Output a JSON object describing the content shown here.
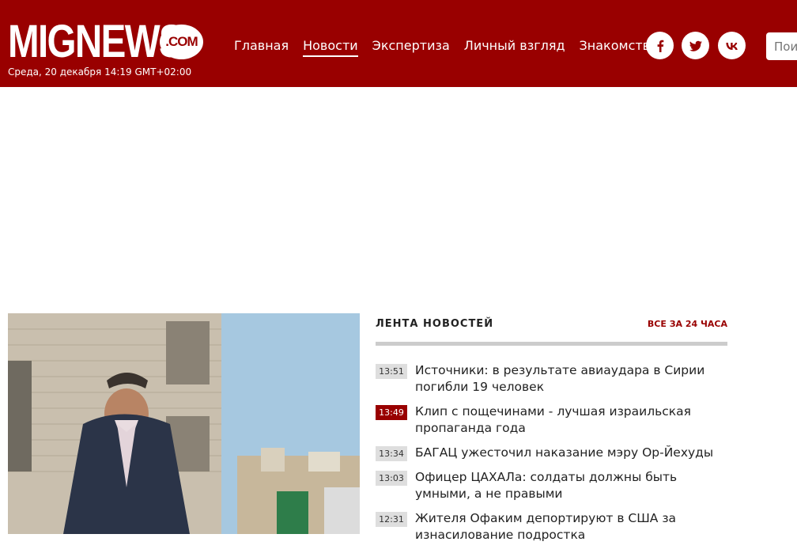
{
  "header": {
    "logo_main": "MIGNEWS",
    "logo_com": ".COM",
    "date": "Среда, 20 декабря 14:19 GMT+02:00",
    "nav": [
      {
        "label": "Главная",
        "active": false
      },
      {
        "label": "Новости",
        "active": true
      },
      {
        "label": "Экспертиза",
        "active": false
      },
      {
        "label": "Личный взгляд",
        "active": false
      },
      {
        "label": "Знакомства",
        "active": false
      }
    ],
    "social": [
      "facebook-icon",
      "twitter-icon",
      "vk-icon"
    ],
    "search_placeholder": "Поиск"
  },
  "feed": {
    "title": "ЛЕНТА НОВОСТЕЙ",
    "all_link": "ВСЕ ЗА 24 ЧАСА",
    "items": [
      {
        "time": "13:51",
        "hot": false,
        "text": "Источники: в результате авиаудара в Сирии погибли 19 человек"
      },
      {
        "time": "13:49",
        "hot": true,
        "text": "Клип с пощечинами - лучшая израильская пропаганда года"
      },
      {
        "time": "13:34",
        "hot": false,
        "text": "БАГАЦ ужесточил наказание мэру Ор-Йехуды"
      },
      {
        "time": "13:03",
        "hot": false,
        "text": "Офицер ЦАХАЛа: солдаты должны быть умными, а не правыми"
      },
      {
        "time": "12:31",
        "hot": false,
        "text": "Жителя Офаким депортируют в США за изнасилование подростка"
      }
    ]
  },
  "colors": {
    "brand": "#990000",
    "time_bg": "#dedede"
  }
}
